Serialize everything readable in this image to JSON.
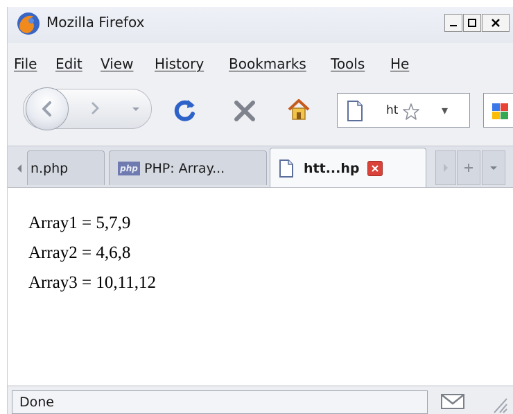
{
  "window": {
    "title": "Mozilla Firefox"
  },
  "menu": {
    "items": [
      "File",
      "Edit",
      "View",
      "History",
      "Bookmarks",
      "Tools",
      "He"
    ]
  },
  "toolbar": {
    "url_text": "ht"
  },
  "tabs": [
    {
      "label": "n.php"
    },
    {
      "label": "PHP: Array..."
    },
    {
      "label": "htt...hp"
    }
  ],
  "content": {
    "lines": [
      "Array1 = 5,7,9",
      "Array2 = 4,6,8",
      "Array3 = 10,11,12"
    ]
  },
  "status": {
    "text": "Done"
  },
  "colors": {
    "accent": "#2d62c8",
    "tab_close": "#d9433a"
  }
}
